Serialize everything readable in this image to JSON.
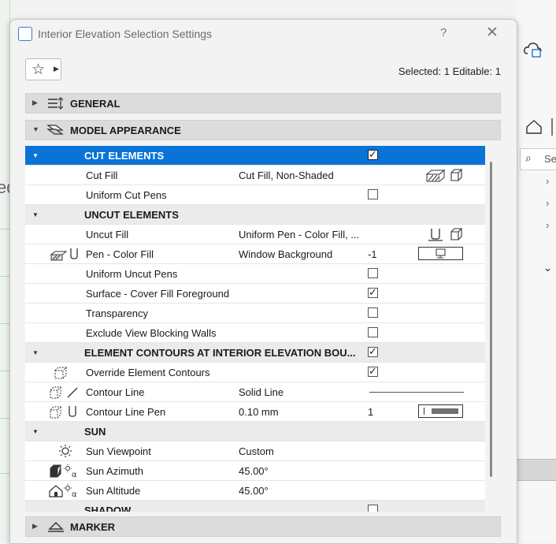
{
  "window": {
    "title": "Interior Elevation Selection Settings",
    "help": "?",
    "close": "✕"
  },
  "favorites": {
    "star": "☆",
    "arrow": "▶"
  },
  "selection_info": "Selected: 1 Editable: 1",
  "sections": {
    "general": "GENERAL",
    "model_appearance": "MODEL APPEARANCE",
    "marker": "MARKER"
  },
  "rows": {
    "cut_elements": "CUT ELEMENTS",
    "cut_fill": {
      "name": "Cut Fill",
      "value": "Cut Fill, Non-Shaded"
    },
    "uniform_cut_pens": {
      "name": "Uniform Cut Pens"
    },
    "uncut_elements": "UNCUT ELEMENTS",
    "uncut_fill": {
      "name": "Uncut Fill",
      "value": "Uniform Pen - Color Fill, ..."
    },
    "pen_color_fill": {
      "name": "Pen - Color Fill",
      "value": "Window Background",
      "num": "-1"
    },
    "uniform_uncut_pens": {
      "name": "Uniform Uncut Pens"
    },
    "surface_cover": {
      "name": "Surface - Cover Fill Foreground"
    },
    "transparency": {
      "name": "Transparency"
    },
    "exclude_walls": {
      "name": "Exclude View Blocking Walls"
    },
    "element_contours": "ELEMENT CONTOURS AT INTERIOR ELEVATION BOU...",
    "override_contours": {
      "name": "Override Element Contours"
    },
    "contour_line": {
      "name": "Contour Line",
      "value": "Solid Line"
    },
    "contour_line_pen": {
      "name": "Contour Line Pen",
      "value": "0.10 mm",
      "num": "1"
    },
    "sun": "SUN",
    "sun_viewpoint": {
      "name": "Sun Viewpoint",
      "value": "Custom"
    },
    "sun_azimuth": {
      "name": "Sun Azimuth",
      "value": "45.00°"
    },
    "sun_altitude": {
      "name": "Sun Altitude",
      "value": "45.00°"
    },
    "shadow": "SHADOW"
  },
  "checkboxes": {
    "cut_elements": true,
    "uniform_cut_pens": false,
    "uniform_uncut_pens": false,
    "surface_cover": true,
    "transparency": false,
    "exclude_walls": false,
    "element_contours": true,
    "override_contours": true,
    "shadow": false
  },
  "background": {
    "right_search": "Sea"
  }
}
